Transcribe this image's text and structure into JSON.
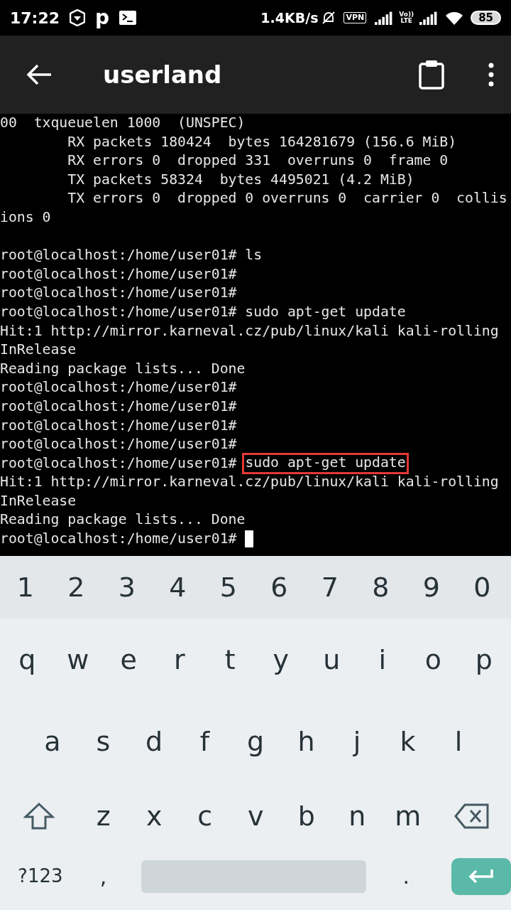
{
  "status_bar": {
    "time": "17:22",
    "app_letter": "p",
    "speed": "1.4KB/s",
    "vpn": "VPN",
    "volte": [
      "Vo))",
      "LTE"
    ],
    "battery": "85"
  },
  "app_bar": {
    "title": "userland"
  },
  "terminal": {
    "cursor": true,
    "lines": [
      {
        "parts": [
          {
            "text": "00  txqueuelen 1000  (UNSPEC)",
            "highlighted": false
          }
        ]
      },
      {
        "parts": [
          {
            "text": "        RX packets 180424  bytes 164281679 (156.6 MiB)",
            "highlighted": false
          }
        ]
      },
      {
        "parts": [
          {
            "text": "        RX errors 0  dropped 331  overruns 0  frame 0",
            "highlighted": false
          }
        ]
      },
      {
        "parts": [
          {
            "text": "        TX packets 58324  bytes 4495021 (4.2 MiB)",
            "highlighted": false
          }
        ]
      },
      {
        "parts": [
          {
            "text": "        TX errors 0  dropped 0 overruns 0  carrier 0  collis",
            "highlighted": false
          }
        ]
      },
      {
        "parts": [
          {
            "text": "ions 0",
            "highlighted": false
          }
        ]
      },
      {
        "blank_before": true,
        "parts": [
          {
            "text": "root@localhost:/home/user01# ls",
            "highlighted": false
          }
        ]
      },
      {
        "parts": [
          {
            "text": "root@localhost:/home/user01#",
            "highlighted": false
          }
        ]
      },
      {
        "parts": [
          {
            "text": "root@localhost:/home/user01#",
            "highlighted": false
          }
        ]
      },
      {
        "parts": [
          {
            "text": "root@localhost:/home/user01# sudo apt-get update",
            "highlighted": false
          }
        ]
      },
      {
        "parts": [
          {
            "text": "Hit:1 http://mirror.karneval.cz/pub/linux/kali kali-rolling",
            "highlighted": false
          }
        ]
      },
      {
        "parts": [
          {
            "text": "InRelease",
            "highlighted": false
          }
        ]
      },
      {
        "parts": [
          {
            "text": "Reading package lists... Done",
            "highlighted": false
          }
        ]
      },
      {
        "parts": [
          {
            "text": "root@localhost:/home/user01#",
            "highlighted": false
          }
        ]
      },
      {
        "parts": [
          {
            "text": "root@localhost:/home/user01#",
            "highlighted": false
          }
        ]
      },
      {
        "parts": [
          {
            "text": "root@localhost:/home/user01#",
            "highlighted": false
          }
        ]
      },
      {
        "parts": [
          {
            "text": "root@localhost:/home/user01#",
            "highlighted": false
          }
        ]
      },
      {
        "parts": [
          {
            "text": "root@localhost:/home/user01#",
            "highlighted": false
          },
          {
            "text": "sudo apt-get update",
            "highlighted": true
          }
        ]
      },
      {
        "parts": [
          {
            "text": "Hit:1 http://mirror.karneval.cz/pub/linux/kali kali-rolling",
            "highlighted": false
          }
        ]
      },
      {
        "parts": [
          {
            "text": "InRelease",
            "highlighted": false
          }
        ]
      },
      {
        "parts": [
          {
            "text": "Reading package lists... Done",
            "highlighted": false
          }
        ]
      },
      {
        "parts": [
          {
            "text": "root@localhost:/home/user01#",
            "highlighted": false
          }
        ]
      }
    ]
  },
  "keyboard": {
    "rows": [
      {
        "kind": "number",
        "keys": [
          "1",
          "2",
          "3",
          "4",
          "5",
          "6",
          "7",
          "8",
          "9",
          "0"
        ]
      },
      {
        "kind": "letters",
        "keys": [
          "q",
          "w",
          "e",
          "r",
          "t",
          "y",
          "u",
          "i",
          "o",
          "p"
        ]
      },
      {
        "kind": "letters",
        "keys": [
          "a",
          "s",
          "d",
          "f",
          "g",
          "h",
          "j",
          "k",
          "l"
        ]
      },
      {
        "kind": "shift",
        "keys": [
          "z",
          "x",
          "c",
          "v",
          "b",
          "n",
          "m"
        ]
      }
    ],
    "bottom": {
      "symbols": "?123",
      "comma": ",",
      "period": "."
    }
  }
}
